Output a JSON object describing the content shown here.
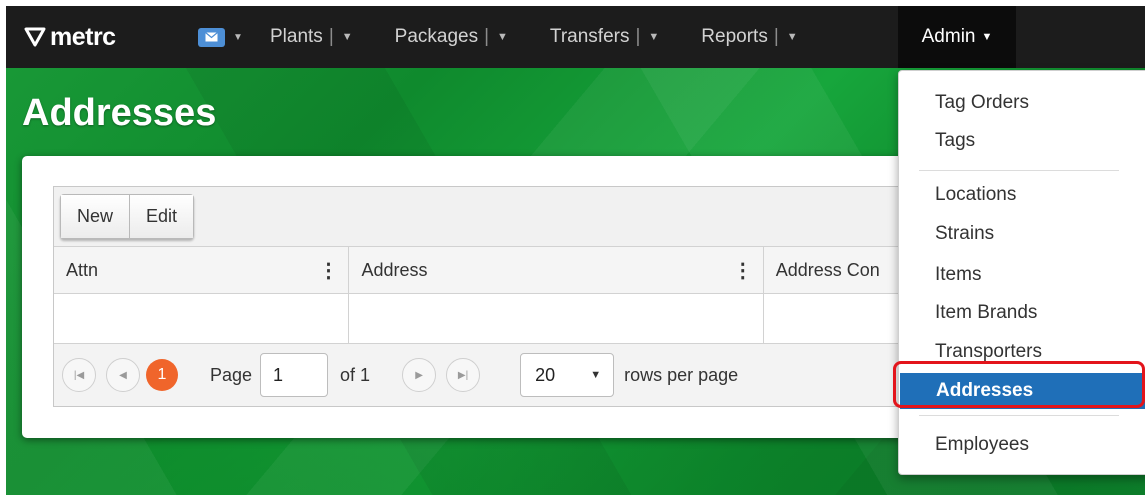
{
  "brand": {
    "name": "metrc"
  },
  "nav": {
    "items": [
      {
        "label": "Plants",
        "sep": "|"
      },
      {
        "label": "Packages",
        "sep": "|"
      },
      {
        "label": "Transfers",
        "sep": "|"
      },
      {
        "label": "Reports",
        "sep": "|"
      }
    ],
    "admin_label": "Admin"
  },
  "page": {
    "title": "Addresses"
  },
  "toolbar": {
    "new_label": "New",
    "edit_label": "Edit"
  },
  "table": {
    "columns": [
      "Attn",
      "Address",
      "Address Con"
    ]
  },
  "pager": {
    "current_page": "1",
    "page_label": "Page",
    "page_value": "1",
    "of_label": "of 1",
    "rows_value": "20",
    "rows_label": "rows per page"
  },
  "admin_menu": {
    "items": [
      "Tag Orders",
      "Tags",
      "Locations",
      "Strains",
      "Items",
      "Item Brands",
      "Transporters",
      "Addresses",
      "Employees"
    ],
    "active": "Addresses"
  },
  "colors": {
    "navbar": "#1c1c1c",
    "accent_orange": "#f0652b",
    "active_blue": "#1f6fb8",
    "highlight_red": "#e3141b",
    "background_green": "#1a9a38"
  }
}
